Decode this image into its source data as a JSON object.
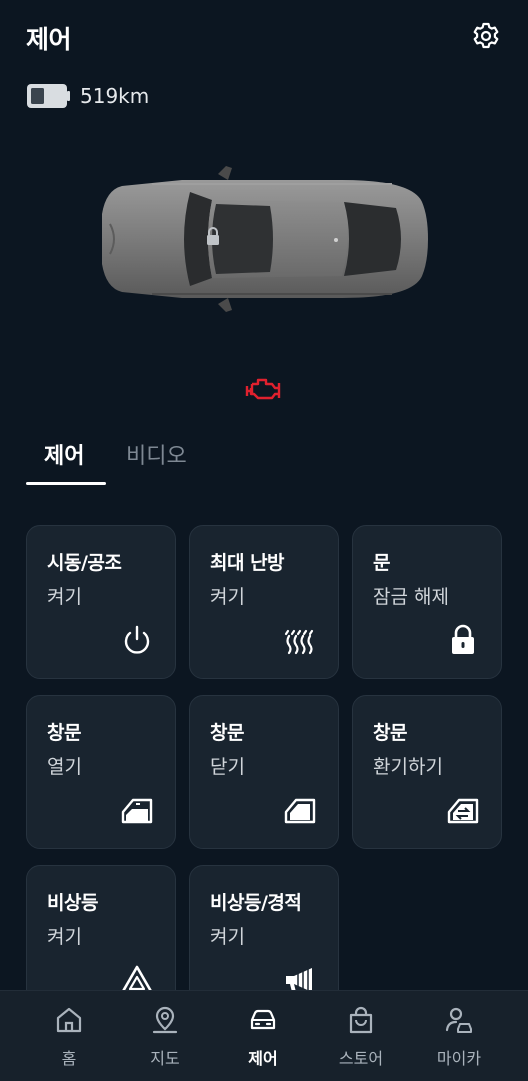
{
  "header": {
    "title": "제어",
    "settings_icon": "gear-icon"
  },
  "status": {
    "range": "519km",
    "battery_level": 0.42
  },
  "colors": {
    "background": "#0c1621",
    "card": "#19242f",
    "warning": "#e0212e"
  },
  "tabs": [
    {
      "label": "제어",
      "active": true
    },
    {
      "label": "비디오",
      "active": false
    }
  ],
  "cards": [
    {
      "title": "시동/공조",
      "subtitle": "켜기",
      "icon": "power-icon"
    },
    {
      "title": "최대 난방",
      "subtitle": "켜기",
      "icon": "heat-icon"
    },
    {
      "title": "문",
      "subtitle": "잠금 해제",
      "icon": "lock-icon"
    },
    {
      "title": "창문",
      "subtitle": "열기",
      "icon": "window-open-icon"
    },
    {
      "title": "창문",
      "subtitle": "닫기",
      "icon": "window-close-icon"
    },
    {
      "title": "창문",
      "subtitle": "환기하기",
      "icon": "window-vent-icon"
    },
    {
      "title": "비상등",
      "subtitle": "켜기",
      "icon": "hazard-icon"
    },
    {
      "title": "비상등/경적",
      "subtitle": "켜기",
      "icon": "horn-icon"
    }
  ],
  "nav": [
    {
      "label": "홈",
      "icon": "home-icon"
    },
    {
      "label": "지도",
      "icon": "map-pin-icon"
    },
    {
      "label": "제어",
      "icon": "car-icon",
      "active": true
    },
    {
      "label": "스토어",
      "icon": "shopping-bag-icon"
    },
    {
      "label": "마이카",
      "icon": "user-car-icon"
    }
  ]
}
